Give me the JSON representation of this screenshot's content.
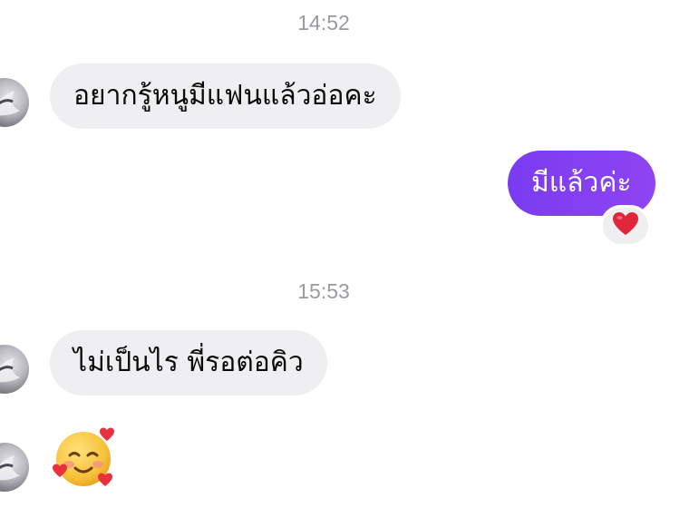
{
  "messages": [
    {
      "type": "timestamp",
      "text": "14:52"
    },
    {
      "type": "incoming",
      "text": "อยากรู้หนูมีแฟนแล้วอ่อคะ"
    },
    {
      "type": "outgoing",
      "text": "มีแล้วค่ะ",
      "reaction": "heart-emoji"
    },
    {
      "type": "timestamp",
      "text": "15:53"
    },
    {
      "type": "incoming",
      "text": "ไม่เป็นไร  พี่รอต่อคิว"
    },
    {
      "type": "incoming-emoji",
      "emoji": "smiling-face-with-hearts"
    }
  ],
  "colors": {
    "incoming_bubble": "#efeff1",
    "outgoing_bubble": "#7c3aed",
    "timestamp": "#9a9ba0",
    "heart": "#e0263a"
  }
}
